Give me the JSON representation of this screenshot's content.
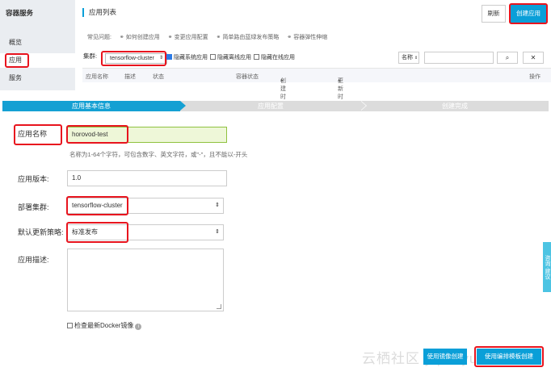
{
  "sidebar": {
    "title": "容器服务",
    "items": [
      {
        "label": "概览"
      },
      {
        "label": "应用"
      },
      {
        "label": "服务"
      }
    ]
  },
  "header": {
    "title": "应用列表",
    "refresh_label": "刷新",
    "create_label": "创建应用"
  },
  "faq": {
    "label": "常见问题:",
    "links": [
      "如何创建应用",
      "变更应用配置",
      "简单路由蓝绿发布策略",
      "容器弹性伸缩"
    ]
  },
  "filters": {
    "cluster_label": "集群:",
    "cluster_value": "tensorflow-cluster",
    "hide_system": "隐藏系统应用",
    "hide_offline": "隐藏离线应用",
    "hide_online": "隐藏在线应用",
    "search_by": "名称",
    "search_placeholder": ""
  },
  "table": {
    "columns": [
      "应用名称",
      "描述",
      "状态",
      "容器状态",
      "创建时间",
      "更新时间",
      "操作"
    ]
  },
  "wizard": {
    "steps": [
      "应用基本信息",
      "应用配置",
      "创建完成"
    ]
  },
  "form": {
    "name_label": "应用名称",
    "name_value": "horovod-test",
    "name_hint": "名称为1-64个字符，可包含数字、英文字符，或\"-\"，且不能以-开头",
    "version_label": "应用版本:",
    "version_value": "1.0",
    "cluster_label": "部署集群:",
    "cluster_value": "tensorflow-cluster",
    "strategy_label": "默认更新策略:",
    "strategy_value": "标准发布",
    "desc_label": "应用描述:",
    "desc_value": "",
    "docker_check_label": "检查最新Docker镜像"
  },
  "actions": {
    "create_from_image": "使用镜像创建",
    "create_from_template": "使用编排模板创建"
  },
  "watermark": "云栖社区 yq.aliyun.com",
  "side_tab": "咨询·建议",
  "colors": {
    "accent": "#0a9fd8",
    "highlight": "#e8141e",
    "input_valid_bg": "#eef7d8"
  }
}
